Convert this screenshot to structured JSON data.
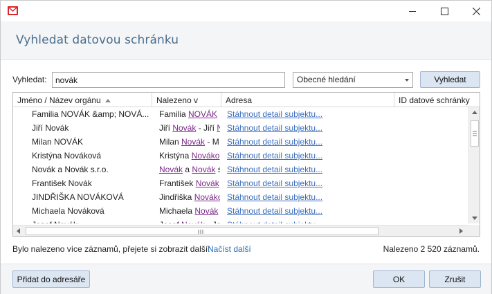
{
  "window": {
    "title": "Vyhledat datovou schránku",
    "minimize_icon": "minimize-icon",
    "maximize_icon": "maximize-icon",
    "close_icon": "close-icon",
    "app_icon": "mail-envelope-icon"
  },
  "search": {
    "label": "Vyhledat:",
    "value": "novák",
    "mode_selected": "Obecné hledání",
    "button_label": "Vyhledat"
  },
  "grid": {
    "columns": [
      "Jméno / Název orgánu",
      "Nalezeno v",
      "Adresa",
      "ID datové schránky"
    ],
    "sort_column": "Jméno / Název orgánu",
    "sort_direction": "ascending",
    "rows": [
      {
        "name": "Familia NOVÁK &amp; NOVÁ...",
        "found_parts": [
          [
            "Familia ",
            false
          ],
          [
            "NOVÁK",
            true
          ]
        ],
        "address": "Stáhnout detail subjektu..."
      },
      {
        "name": "Jiří Novák",
        "found_parts": [
          [
            "Jiří ",
            false
          ],
          [
            "Novák",
            true
          ],
          [
            " - Jiří ",
            false
          ],
          [
            "N",
            true
          ]
        ],
        "address": "Stáhnout detail subjektu..."
      },
      {
        "name": "Milan NOVÁK",
        "found_parts": [
          [
            "Milan ",
            false
          ],
          [
            "Novák",
            true
          ],
          [
            " - M",
            false
          ]
        ],
        "address": "Stáhnout detail subjektu..."
      },
      {
        "name": "Kristýna Nováková",
        "found_parts": [
          [
            "Kristýna ",
            false
          ],
          [
            "Nováko",
            true
          ]
        ],
        "address": "Stáhnout detail subjektu..."
      },
      {
        "name": "Novák a Novák s.r.o.",
        "found_parts": [
          [
            "Novák",
            true
          ],
          [
            " a ",
            false
          ],
          [
            "Novák",
            true
          ],
          [
            " s",
            false
          ]
        ],
        "address": "Stáhnout detail subjektu..."
      },
      {
        "name": "František Novák",
        "found_parts": [
          [
            "František ",
            false
          ],
          [
            "Novák",
            true
          ]
        ],
        "address": "Stáhnout detail subjektu..."
      },
      {
        "name": "JINDŘIŠKA NOVÁKOVÁ",
        "found_parts": [
          [
            "Jindřiška ",
            false
          ],
          [
            "Nováko",
            true
          ]
        ],
        "address": "Stáhnout detail subjektu..."
      },
      {
        "name": "Michaela Nováková",
        "found_parts": [
          [
            "Michaela ",
            false
          ],
          [
            "Novák",
            true
          ]
        ],
        "address": "Stáhnout detail subjektu..."
      },
      {
        "name": "Josef Novák",
        "found_parts": [
          [
            "Josef ",
            false
          ],
          [
            "Novák",
            true
          ],
          [
            " - Jos",
            false
          ]
        ],
        "address": "Stáhnout detail subjektu..."
      }
    ]
  },
  "status": {
    "more_records_text": "Bylo nalezeno více záznamů, přejete si zobrazit další:",
    "load_more_link": "Načíst další",
    "count_text": "Nalezeno 2 520 záznamů."
  },
  "footer": {
    "add_button": "Přidat do adresáře",
    "ok_button": "OK",
    "cancel_button": "Zrušit"
  },
  "colors": {
    "accent_title": "#4a6d8c",
    "link": "#3b6ebe",
    "highlight": "#7a2a88",
    "button_bg": "#dce6f2",
    "app_icon": "#d9262a"
  }
}
